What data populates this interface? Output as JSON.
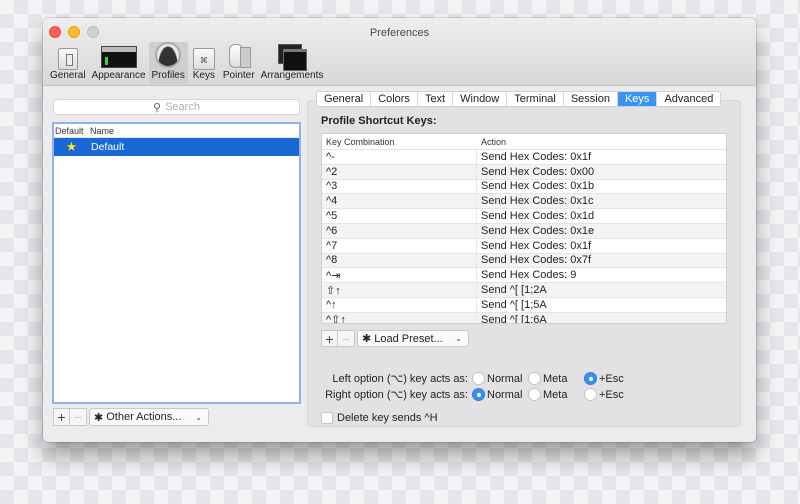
{
  "window": {
    "title": "Preferences",
    "traffic_lights": [
      "close",
      "minimize",
      "zoom"
    ]
  },
  "toolbar": {
    "items": [
      {
        "label": "General",
        "icon": "general-switch-icon",
        "active": false
      },
      {
        "label": "Appearance",
        "icon": "terminal-window-icon",
        "active": false
      },
      {
        "label": "Profiles",
        "icon": "person-silhouette-icon",
        "active": true
      },
      {
        "label": "Keys",
        "icon": "command-key-icon",
        "active": false
      },
      {
        "label": "Pointer",
        "icon": "mouse-icon",
        "active": false
      },
      {
        "label": "Arrangements",
        "icon": "stacked-windows-icon",
        "active": false
      }
    ]
  },
  "profiles_panel": {
    "search_placeholder": "Search",
    "columns": [
      "Default",
      "Name"
    ],
    "profiles": [
      {
        "is_default": true,
        "name": "Default",
        "selected": true
      }
    ],
    "add_label": "+",
    "remove_label": "−",
    "other_actions_label": "Other Actions..."
  },
  "tabs": [
    {
      "label": "General",
      "active": false
    },
    {
      "label": "Colors",
      "active": false
    },
    {
      "label": "Text",
      "active": false
    },
    {
      "label": "Window",
      "active": false
    },
    {
      "label": "Terminal",
      "active": false
    },
    {
      "label": "Session",
      "active": false
    },
    {
      "label": "Keys",
      "active": true
    },
    {
      "label": "Advanced",
      "active": false
    }
  ],
  "keys": {
    "section_title": "Profile Shortcut Keys:",
    "columns": {
      "key": "Key Combination",
      "action": "Action"
    },
    "rows": [
      {
        "key": "^-",
        "action": "Send Hex Codes: 0x1f"
      },
      {
        "key": "^2",
        "action": "Send Hex Codes: 0x00"
      },
      {
        "key": "^3",
        "action": "Send Hex Codes: 0x1b"
      },
      {
        "key": "^4",
        "action": "Send Hex Codes: 0x1c"
      },
      {
        "key": "^5",
        "action": "Send Hex Codes: 0x1d"
      },
      {
        "key": "^6",
        "action": "Send Hex Codes: 0x1e"
      },
      {
        "key": "^7",
        "action": "Send Hex Codes: 0x1f"
      },
      {
        "key": "^8",
        "action": "Send Hex Codes: 0x7f"
      },
      {
        "key": "^⇥",
        "action": "Send Hex Codes: 9"
      },
      {
        "key": "⇧↑",
        "action": "Send ^[ [1;2A"
      },
      {
        "key": "^↑",
        "action": "Send ^[ [1;5A"
      },
      {
        "key": "^⇧↑",
        "action": "Send ^[ [1;6A"
      }
    ],
    "add_label": "+",
    "remove_label": "−",
    "load_preset_label": "Load Preset...",
    "left_option": {
      "label": "Left option (⌥) key acts as:",
      "choices": [
        "Normal",
        "Meta",
        "+Esc"
      ],
      "selected": "+Esc"
    },
    "right_option": {
      "label": "Right option (⌥) key acts as:",
      "choices": [
        "Normal",
        "Meta",
        "+Esc"
      ],
      "selected": "Normal"
    },
    "delete_sends_ctrl_h": {
      "label": "Delete key sends ^H",
      "checked": false
    }
  },
  "colors": {
    "accent": "#3b93f2",
    "selection": "#1a68d5",
    "close": "#fc5f57",
    "minimize": "#fdbc2e"
  }
}
